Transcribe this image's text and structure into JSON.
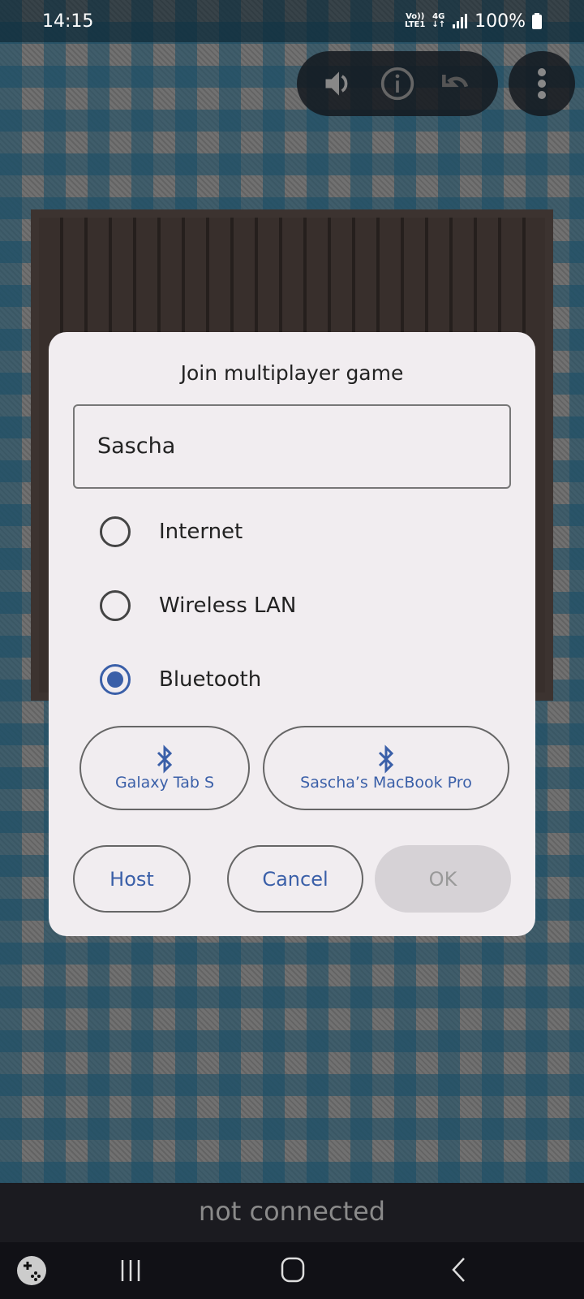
{
  "status_bar": {
    "time": "14:15",
    "volte": "Vo))",
    "lte": "LTE1",
    "network": "4G",
    "battery": "100%"
  },
  "toolbar": {
    "icons": [
      "speaker-icon",
      "info-icon",
      "undo-icon",
      "more-vert-icon"
    ]
  },
  "dialog": {
    "title": "Join multiplayer game",
    "name_value": "Sascha",
    "options": [
      {
        "label": "Internet",
        "selected": false
      },
      {
        "label": "Wireless LAN",
        "selected": false
      },
      {
        "label": "Bluetooth",
        "selected": true
      }
    ],
    "devices": [
      "Galaxy Tab S",
      "Sascha’s MacBook Pro"
    ],
    "buttons": {
      "host": "Host",
      "cancel": "Cancel",
      "ok": "OK"
    }
  },
  "connection_status": "not connected",
  "colors": {
    "accent": "#3a5fa8",
    "dialog_bg": "#f1edf0"
  }
}
